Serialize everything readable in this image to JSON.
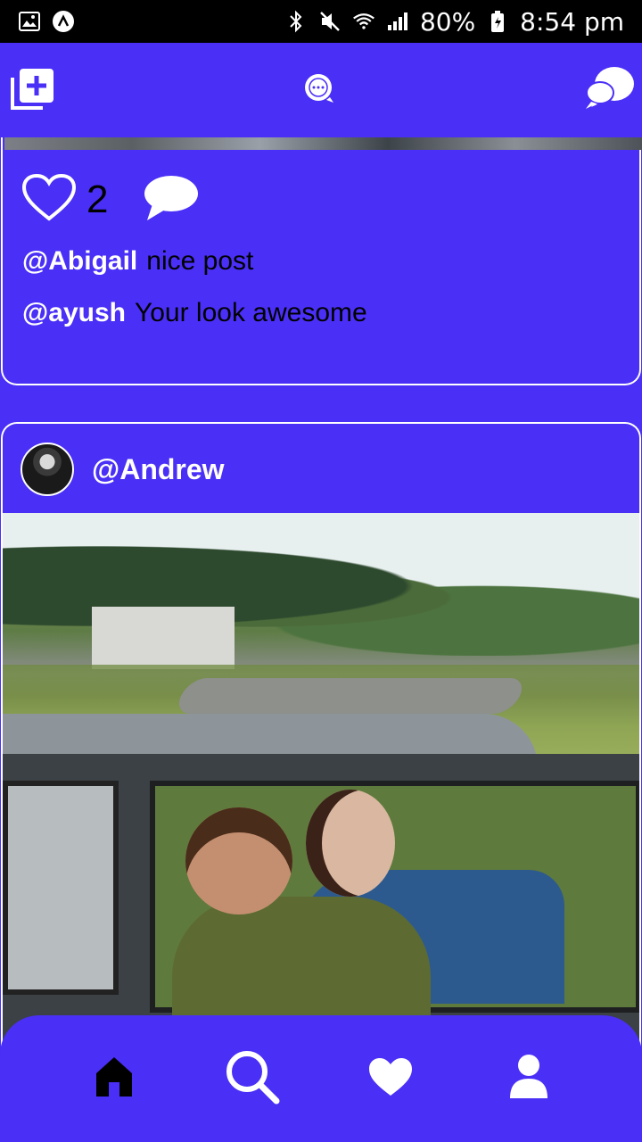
{
  "status_bar": {
    "battery": "80%",
    "time": "8:54 pm"
  },
  "app_bar": {
    "left_icon": "add-post-icon",
    "center_icon": "app-logo-icon",
    "right_icon": "chat-icon"
  },
  "posts": [
    {
      "likes": "2",
      "comments": [
        {
          "user": "@Abigail",
          "text": "nice post"
        },
        {
          "user": "@ayush",
          "text": "Your look awesome"
        }
      ]
    },
    {
      "username": "@Andrew"
    }
  ],
  "bottom_nav": {
    "items": [
      "home-icon",
      "search-icon",
      "heart-icon",
      "profile-icon"
    ]
  },
  "colors": {
    "primary": "#4a2ff7",
    "text_dark": "#000000",
    "text_light": "#ffffff"
  }
}
